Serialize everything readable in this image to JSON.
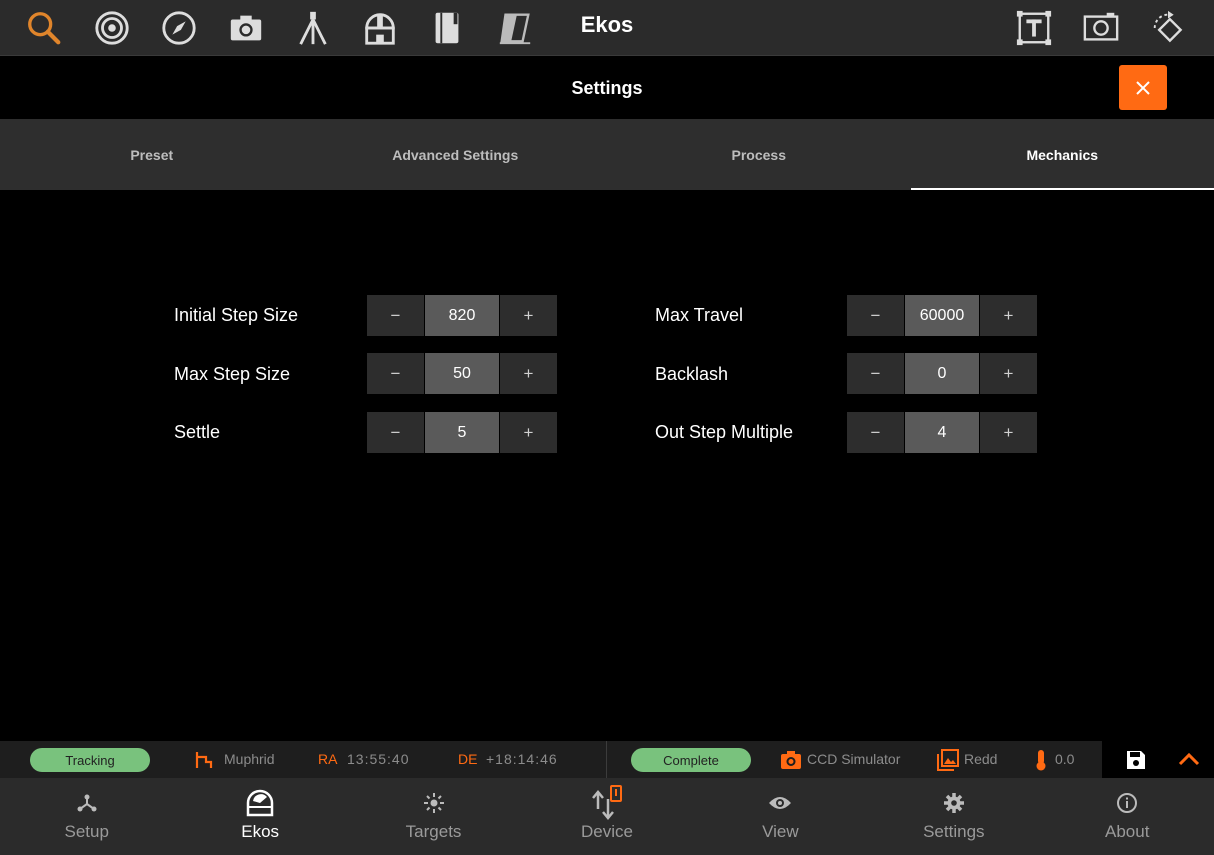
{
  "topbar": {
    "title": "Ekos",
    "icons": [
      "search-icon",
      "target-icon",
      "compass-icon",
      "camera-icon",
      "tripod-icon",
      "observatory-icon",
      "notebook-icon",
      "flat-field-icon",
      "text-frame-icon",
      "screenshot-icon",
      "rotate-icon"
    ],
    "accent": "#ff6a13"
  },
  "settings": {
    "title": "Settings",
    "close_icon": "close-icon"
  },
  "tabs": [
    {
      "label": "Preset",
      "active": false
    },
    {
      "label": "Advanced Settings",
      "active": false
    },
    {
      "label": "Process",
      "active": false
    },
    {
      "label": "Mechanics",
      "active": true
    }
  ],
  "mechanics": {
    "left": [
      {
        "label": "Initial Step Size",
        "value": "820"
      },
      {
        "label": "Max Step Size",
        "value": "50"
      },
      {
        "label": "Settle",
        "value": "5"
      }
    ],
    "right": [
      {
        "label": "Max Travel",
        "value": "60000"
      },
      {
        "label": "Backlash",
        "value": "0"
      },
      {
        "label": "Out Step Multiple",
        "value": "4"
      }
    ],
    "minus": "−",
    "plus": "+"
  },
  "status": {
    "tracking": "Tracking",
    "target": "Muphrid",
    "ra_key": "RA",
    "ra_value": "13:55:40",
    "de_key": "DE",
    "de_value": "+18:14:46",
    "capture": "Complete",
    "camera": "CCD Simulator",
    "filter": "Redd",
    "temperature": "0.0",
    "pill_color": "#79c27d"
  },
  "nav": [
    {
      "label": "Setup",
      "icon": "setup-icon",
      "active": false
    },
    {
      "label": "Ekos",
      "icon": "ekos-icon",
      "active": true
    },
    {
      "label": "Targets",
      "icon": "targets-icon",
      "active": false
    },
    {
      "label": "Device",
      "icon": "device-icon",
      "active": false
    },
    {
      "label": "View",
      "icon": "eye-icon",
      "active": false
    },
    {
      "label": "Settings",
      "icon": "gear-icon",
      "active": false
    },
    {
      "label": "About",
      "icon": "info-icon",
      "active": false
    }
  ]
}
